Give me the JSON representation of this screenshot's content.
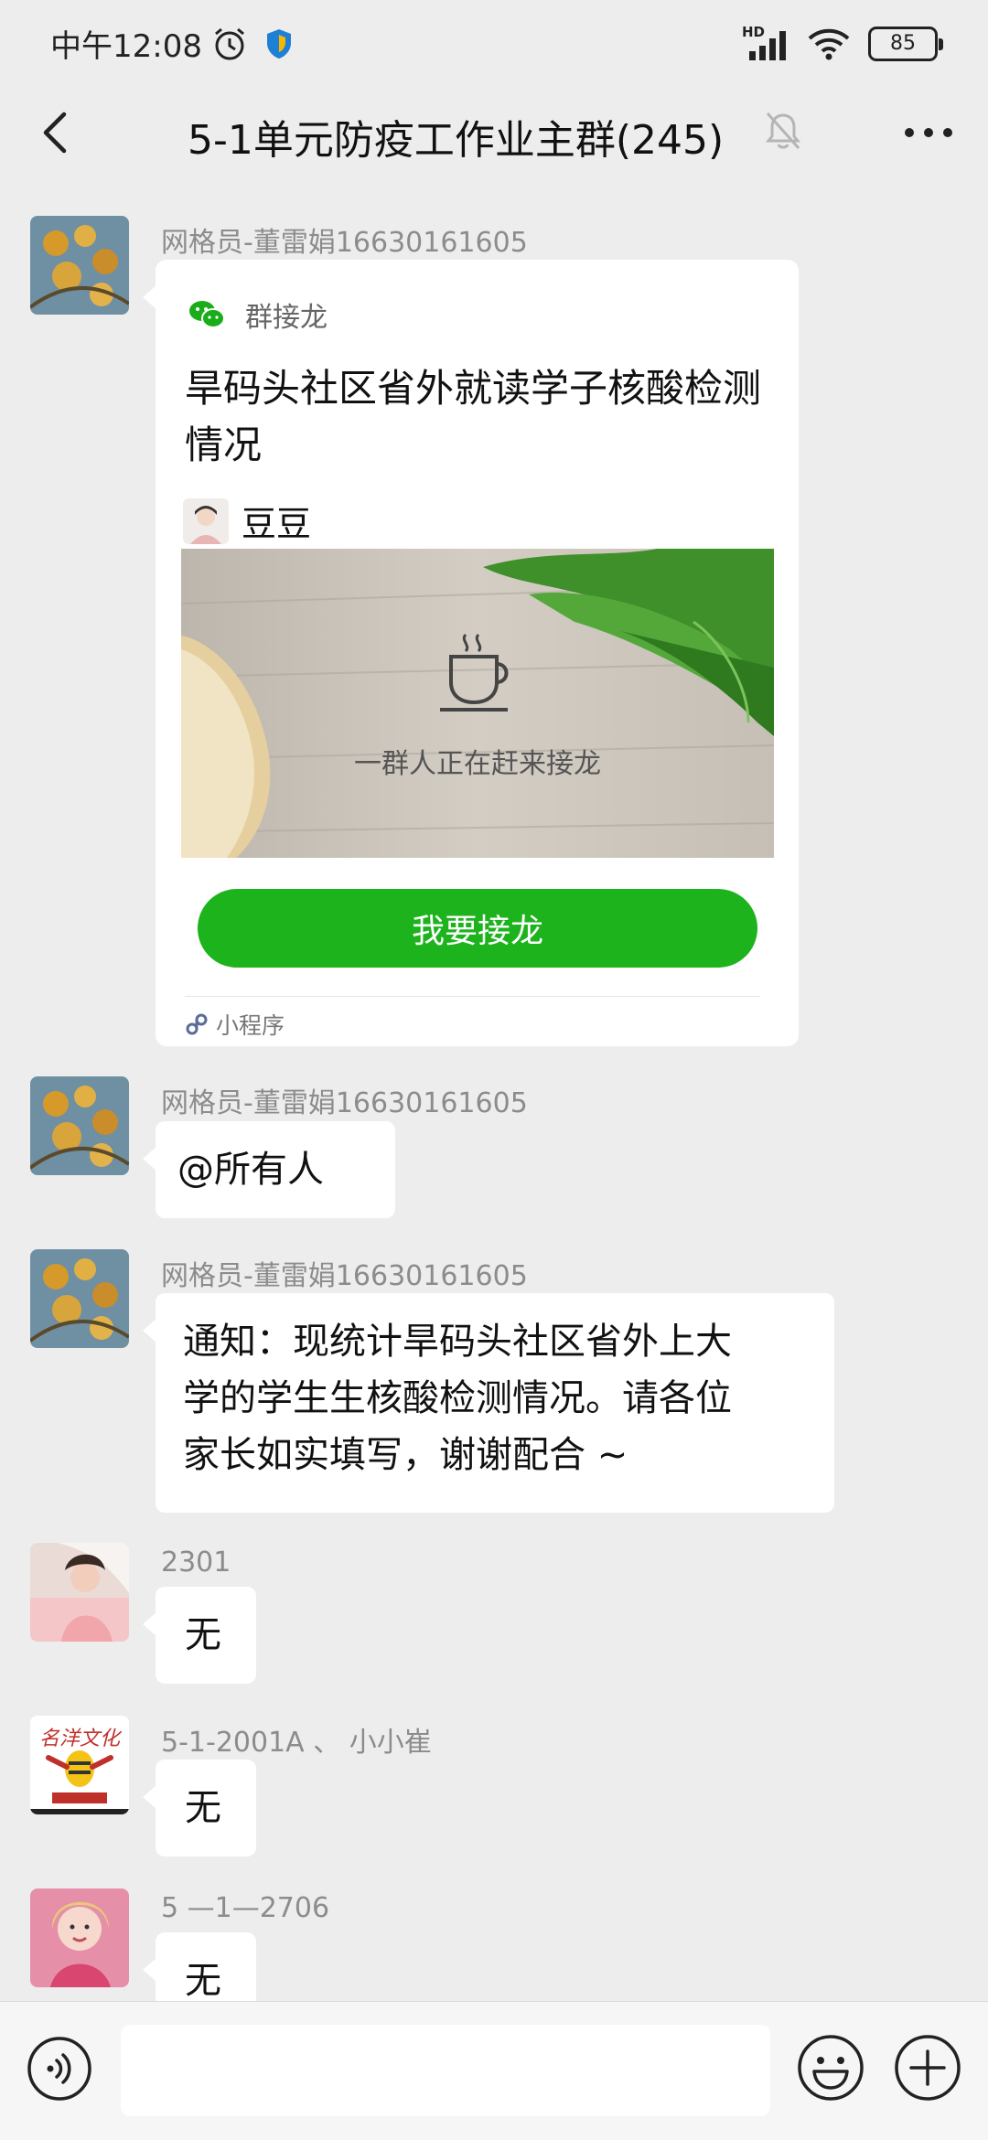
{
  "status_bar": {
    "time": "中午12:08",
    "network_badge": "HD",
    "battery": "85"
  },
  "header": {
    "title": "5-1单元防疫工作业主群(245)",
    "back_icon": "chevron-left-icon",
    "mute_icon": "bell-off-icon",
    "more_icon": "more-dots-icon"
  },
  "messages": [
    {
      "type": "card",
      "sender": "网格员-董雷娟16630161605",
      "card": {
        "app_name": "群接龙",
        "title": "旱码头社区省外就读学子核酸检测情况",
        "author": "豆豆",
        "image_caption": "一群人正在赶来接龙",
        "button": "我要接龙",
        "footer": "小程序"
      }
    },
    {
      "type": "text",
      "sender": "网格员-董雷娟16630161605",
      "text": "@所有人"
    },
    {
      "type": "text",
      "sender": "网格员-董雷娟16630161605",
      "lines": [
        "通知：现统计旱码头社区省外上大",
        "学的学生生核酸检测情况。请各位",
        "家长如实填写，谢谢配合 ~"
      ]
    },
    {
      "type": "text",
      "sender": "2301",
      "text": "无"
    },
    {
      "type": "text",
      "sender": "5-1-2001A 、 小小崔",
      "text": "无",
      "avatar_text": "名洋文化"
    },
    {
      "type": "text",
      "sender": "5 —1—2706",
      "text": "无"
    }
  ],
  "input_bar": {
    "voice_icon": "voice-icon",
    "emoji_icon": "emoji-icon",
    "plus_icon": "plus-icon",
    "placeholder": ""
  },
  "colors": {
    "background": "#ededed",
    "bubble": "#ffffff",
    "accent_green": "#1db31d",
    "sender_gray": "#8c8c8c"
  }
}
